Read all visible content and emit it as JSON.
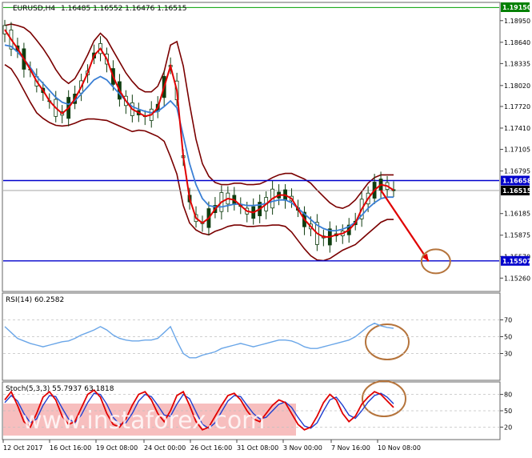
{
  "chart_data": [
    {
      "type": "candlestick",
      "header": {
        "symbol_tf": "EURUSD,H4",
        "ohlc": "1.16485 1.16552 1.16476 1.16515"
      },
      "y_ticks": [
        "1.18950",
        "1.18640",
        "1.18335",
        "1.18020",
        "1.17720",
        "1.17410",
        "1.17105",
        "1.16795",
        "1.16185",
        "1.15875",
        "1.15570",
        "1.15260"
      ],
      "y_range": [
        1.1508,
        1.192
      ],
      "price_tags": {
        "top": "1.19150",
        "resistance": "1.16658",
        "current": "1.16515",
        "support": "1.15507"
      },
      "levels": {
        "top": 1.1915,
        "resistance": 1.16658,
        "current": 1.16515,
        "support": 1.15507
      },
      "x_labels": [
        "12 Oct 2017",
        "16 Oct 16:00",
        "19 Oct 08:00",
        "24 Oct 00:00",
        "26 Oct 16:00",
        "31 Oct 08:00",
        "3 Nov 00:00",
        "7 Nov 16:00",
        "10 Nov 08:00"
      ],
      "ma_fast": [
        1.1882,
        1.1868,
        1.1855,
        1.184,
        1.1825,
        1.1808,
        1.1795,
        1.178,
        1.177,
        1.1762,
        1.177,
        1.1783,
        1.18,
        1.182,
        1.1845,
        1.1855,
        1.184,
        1.1815,
        1.1795,
        1.178,
        1.1768,
        1.1763,
        1.1758,
        1.176,
        1.177,
        1.18,
        1.183,
        1.1795,
        1.17,
        1.164,
        1.1612,
        1.1605,
        1.1612,
        1.1625,
        1.1635,
        1.164,
        1.1638,
        1.163,
        1.1622,
        1.162,
        1.1625,
        1.1632,
        1.164,
        1.1645,
        1.1645,
        1.164,
        1.1625,
        1.161,
        1.16,
        1.159,
        1.1585,
        1.1585,
        1.1588,
        1.159,
        1.1595,
        1.1605,
        1.1625,
        1.164,
        1.1652,
        1.166,
        1.1658,
        1.1652
      ],
      "ma_slow": [
        1.186,
        1.1858,
        1.185,
        1.184,
        1.1828,
        1.1815,
        1.1805,
        1.1795,
        1.1785,
        1.1778,
        1.1775,
        1.178,
        1.179,
        1.18,
        1.181,
        1.1815,
        1.181,
        1.18,
        1.179,
        1.178,
        1.1772,
        1.1768,
        1.1765,
        1.1763,
        1.1765,
        1.1772,
        1.178,
        1.177,
        1.173,
        1.169,
        1.166,
        1.164,
        1.163,
        1.1628,
        1.1628,
        1.163,
        1.1632,
        1.1632,
        1.163,
        1.163,
        1.1631,
        1.1633,
        1.1636,
        1.1638,
        1.1638,
        1.1634,
        1.1626,
        1.1618,
        1.161,
        1.1602,
        1.1597,
        1.1594,
        1.1594,
        1.1596,
        1.16,
        1.1606,
        1.1616,
        1.1626,
        1.1634,
        1.164,
        1.1642,
        1.1642
      ],
      "projection": {
        "from": [
          59,
          1.1652
        ],
        "to": [
          66.5,
          1.155
        ]
      }
    },
    {
      "type": "line",
      "indicator": "RSI",
      "label": "RSI(14) 60.2582",
      "y_ticks": [
        "70",
        "50",
        "30"
      ],
      "y_range": [
        0,
        100
      ],
      "values": [
        62,
        55,
        48,
        45,
        42,
        40,
        38,
        40,
        42,
        44,
        45,
        48,
        52,
        55,
        58,
        62,
        58,
        52,
        48,
        46,
        45,
        45,
        46,
        46,
        48,
        55,
        62,
        45,
        30,
        25,
        25,
        28,
        30,
        32,
        36,
        38,
        40,
        42,
        40,
        38,
        40,
        42,
        44,
        46,
        46,
        45,
        42,
        38,
        36,
        36,
        38,
        40,
        42,
        44,
        46,
        50,
        56,
        62,
        66,
        63,
        61,
        60
      ]
    },
    {
      "type": "line",
      "indicator": "Stochastic",
      "label": "Stoch(5,3,3) 55.7937 63.1818",
      "y_ticks": [
        "80",
        "50",
        "20"
      ],
      "y_range": [
        0,
        100
      ],
      "main": [
        70,
        85,
        60,
        30,
        20,
        45,
        75,
        85,
        70,
        40,
        25,
        30,
        55,
        80,
        88,
        75,
        45,
        25,
        20,
        35,
        60,
        80,
        85,
        70,
        45,
        30,
        50,
        78,
        85,
        60,
        30,
        15,
        20,
        40,
        60,
        78,
        82,
        70,
        50,
        35,
        30,
        45,
        60,
        70,
        65,
        45,
        25,
        15,
        20,
        40,
        65,
        80,
        70,
        45,
        30,
        40,
        62,
        75,
        85,
        80,
        68,
        56
      ],
      "signal": [
        65,
        78,
        68,
        45,
        28,
        35,
        60,
        78,
        76,
        55,
        35,
        28,
        42,
        65,
        82,
        80,
        62,
        38,
        25,
        28,
        45,
        68,
        80,
        76,
        60,
        42,
        40,
        62,
        80,
        72,
        48,
        25,
        18,
        28,
        48,
        68,
        78,
        76,
        60,
        45,
        35,
        38,
        50,
        62,
        66,
        56,
        38,
        22,
        18,
        28,
        50,
        70,
        75,
        60,
        42,
        36,
        50,
        66,
        78,
        82,
        75,
        63
      ]
    }
  ],
  "watermark": "www.instaforex.com",
  "colors": {
    "candle": "#0f3d0f",
    "ma_fast": "#e00000",
    "ma_slow": "#3a7fd5",
    "bands": "#7a0000",
    "level_line": "#0000cc",
    "price_tag_bg": "#0000cc",
    "current_tag_bg": "#000000",
    "rsi_line": "#6aa6e8",
    "stoch_main": "#e00000",
    "stoch_signal": "#2040d0",
    "circle": "#b5743c",
    "arrow": "#e00000",
    "watermark_band": "#f4a8a8",
    "grid": "#c0c0c0"
  }
}
